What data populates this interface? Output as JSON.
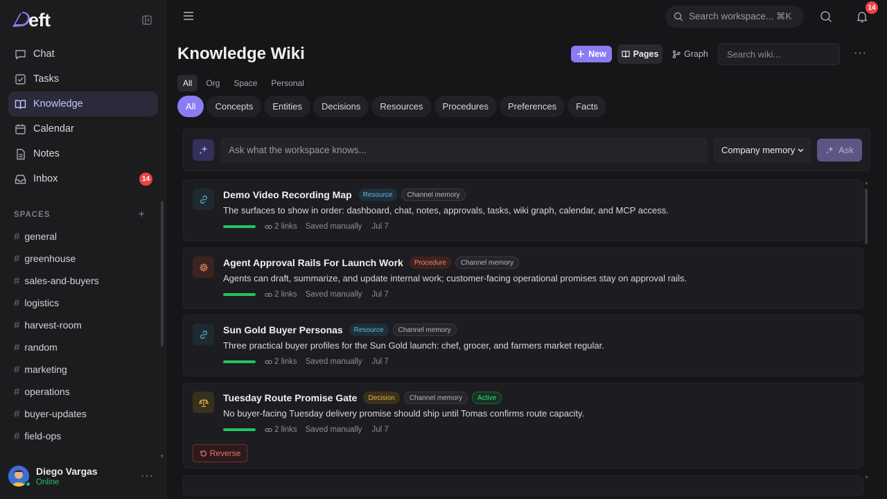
{
  "brand": {
    "name": "eft",
    "accent": "#8b7cf6"
  },
  "sidebar": {
    "nav": [
      {
        "label": "Chat",
        "icon": "chat-icon"
      },
      {
        "label": "Tasks",
        "icon": "tasks-icon"
      },
      {
        "label": "Knowledge",
        "icon": "book-icon",
        "active": true
      },
      {
        "label": "Calendar",
        "icon": "calendar-icon"
      },
      {
        "label": "Notes",
        "icon": "notes-icon"
      },
      {
        "label": "Inbox",
        "icon": "inbox-icon",
        "badge": "14"
      }
    ],
    "spaces_heading": "SPACES",
    "spaces": [
      "general",
      "greenhouse",
      "sales-and-buyers",
      "logistics",
      "harvest-room",
      "random",
      "marketing",
      "operations",
      "buyer-updates",
      "field-ops"
    ],
    "user": {
      "name": "Diego Vargas",
      "status": "Online"
    }
  },
  "topbar": {
    "search_placeholder": "Search workspace... ⌘K",
    "notification_count": "14"
  },
  "header": {
    "title": "Knowledge Wiki",
    "new_label": "New",
    "pages_label": "Pages",
    "graph_label": "Graph",
    "wiki_search_placeholder": "Search wiki..."
  },
  "scope_tabs": [
    {
      "label": "All",
      "active": true
    },
    {
      "label": "Org"
    },
    {
      "label": "Space"
    },
    {
      "label": "Personal"
    }
  ],
  "type_chips": [
    {
      "label": "All",
      "active": true
    },
    {
      "label": "Concepts"
    },
    {
      "label": "Entities"
    },
    {
      "label": "Decisions"
    },
    {
      "label": "Resources"
    },
    {
      "label": "Procedures"
    },
    {
      "label": "Preferences"
    },
    {
      "label": "Facts"
    }
  ],
  "ask": {
    "placeholder": "Ask what the workspace knows...",
    "source_select": "Company memory",
    "button_label": "Ask"
  },
  "entries": [
    {
      "title": "Demo Video Recording Map",
      "type": "Resource",
      "type_class": "resource",
      "icon": "link-icon",
      "scope_tag": "Channel memory",
      "description": "The surfaces to show in order: dashboard, chat, notes, approvals, tasks, wiki graph, calendar, and MCP access.",
      "strength": 1.0,
      "links": "2 links",
      "saved": "Saved manually",
      "date": "Jul 7"
    },
    {
      "title": "Agent Approval Rails For Launch Work",
      "type": "Procedure",
      "type_class": "procedure",
      "icon": "gear-icon",
      "scope_tag": "Channel memory",
      "description": "Agents can draft, summarize, and update internal work; customer-facing operational promises stay on approval rails.",
      "strength": 1.0,
      "links": "2 links",
      "saved": "Saved manually",
      "date": "Jul 7"
    },
    {
      "title": "Sun Gold Buyer Personas",
      "type": "Resource",
      "type_class": "resource",
      "icon": "link-icon",
      "scope_tag": "Channel memory",
      "description": "Three practical buyer profiles for the Sun Gold launch: chef, grocer, and farmers market regular.",
      "strength": 1.0,
      "links": "2 links",
      "saved": "Saved manually",
      "date": "Jul 7"
    },
    {
      "title": "Tuesday Route Promise Gate",
      "type": "Decision",
      "type_class": "decision",
      "icon": "scale-icon",
      "scope_tag": "Channel memory",
      "status_tag": "Active",
      "description": "No buyer-facing Tuesday delivery promise should ship until Tomas confirms route capacity.",
      "strength": 1.0,
      "links": "2 links",
      "saved": "Saved manually",
      "date": "Jul 7",
      "action_label": "Reverse"
    }
  ]
}
